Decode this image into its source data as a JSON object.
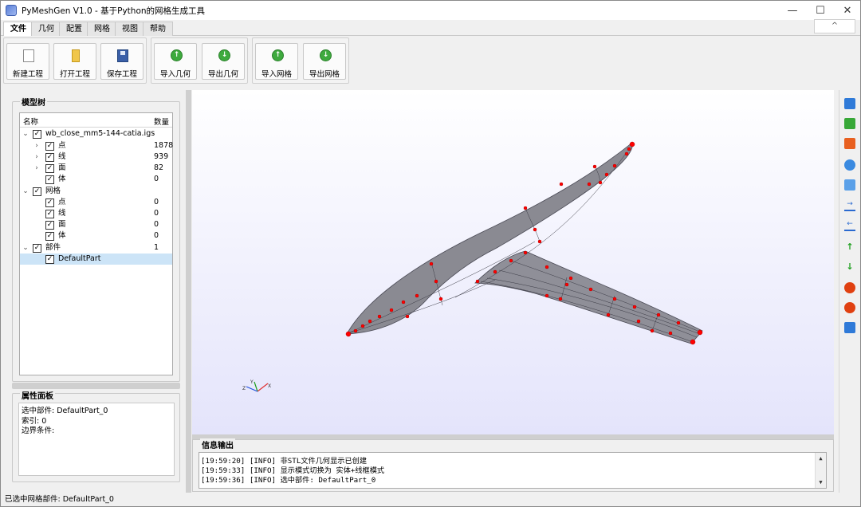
{
  "window": {
    "title": "PyMeshGen V1.0 - 基于Python的网格生成工具",
    "minimize": "—",
    "maximize": "☐",
    "close": "✕"
  },
  "menu": {
    "tabs": [
      "文件",
      "几何",
      "配置",
      "网格",
      "视图",
      "帮助"
    ],
    "active_tab": "文件",
    "collapse_label": "^"
  },
  "ribbon": {
    "new_project": "新建工程",
    "open_project": "打开工程",
    "save_project": "保存工程",
    "import_geometry": "导入几何",
    "export_geometry": "导出几何",
    "import_mesh": "导入网格",
    "export_mesh": "导出网格"
  },
  "model_tree": {
    "title": "模型树",
    "col_name": "名称",
    "col_count": "数量",
    "file_node": "wb_close_mm5-144-catia.igs",
    "geometry": [
      {
        "label": "点",
        "count": "1878"
      },
      {
        "label": "线",
        "count": "939"
      },
      {
        "label": "面",
        "count": "82"
      },
      {
        "label": "体",
        "count": "0"
      }
    ],
    "mesh_node": "网格",
    "mesh": [
      {
        "label": "点",
        "count": "0"
      },
      {
        "label": "线",
        "count": "0"
      },
      {
        "label": "面",
        "count": "0"
      },
      {
        "label": "体",
        "count": "0"
      }
    ],
    "parts_node": "部件",
    "parts_count": "1",
    "selected_part": "DefaultPart"
  },
  "properties": {
    "title": "属性面板",
    "line1": "选中部件: DefaultPart_0",
    "line2": "索引: 0",
    "line3": "边界条件:"
  },
  "output": {
    "title": "信息输出",
    "lines": [
      "[19:59:20] [INFO] 非STL文件几何显示已创建",
      "[19:59:33] [INFO] 显示模式切换为 实体+线框模式",
      "[19:59:36] [INFO] 选中部件: DefaultPart_0"
    ]
  },
  "axes": {
    "x": "X",
    "y": "Y",
    "z": "Z"
  },
  "status": "已选中网格部件: DefaultPart_0",
  "colors": {
    "mesh_body": "#8a8a92",
    "points": "#ff0000",
    "selection": "#cce4f7"
  },
  "right_toolbar_icons": [
    "iso-view-icon",
    "front-view-icon",
    "back-view-icon",
    "reset-view-icon",
    "fit-view-icon",
    "x-positive-icon",
    "x-negative-icon",
    "y-positive-icon",
    "y-negative-icon",
    "z-positive-icon",
    "z-negative-icon",
    "orthographic-icon"
  ]
}
